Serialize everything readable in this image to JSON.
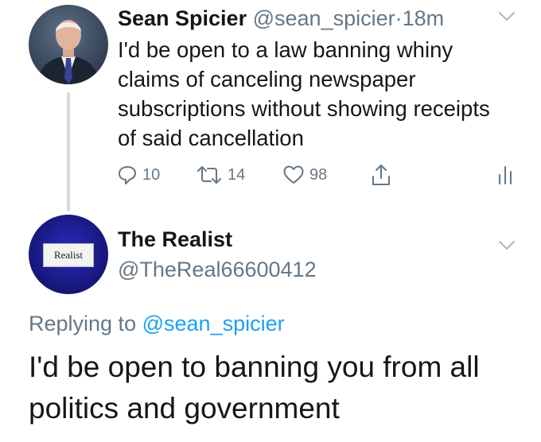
{
  "tweet": {
    "name": "Sean Spicier",
    "handle": "@sean_spicier",
    "separator": "·",
    "time": "18m",
    "text": "I'd be open to a law banning whiny claims of canceling newspaper subscriptions without showing receipts of said cancellation",
    "replies": "10",
    "retweets": "14",
    "likes": "98"
  },
  "reply_tweet": {
    "name": "The Realist",
    "handle": "@TheReal66600412",
    "avatar_card_text": "Realist",
    "replying_prefix": "Replying to",
    "replying_to": "@sean_spicier",
    "text": "I'd be open to banning you from all politics and government"
  },
  "colors": {
    "text": "#14171a",
    "secondary": "#657786",
    "link": "#1da1f2",
    "thread_line": "#d4dbe1"
  },
  "icons": [
    "chevron-down-icon",
    "reply-icon",
    "retweet-icon",
    "like-icon",
    "share-icon",
    "analytics-icon"
  ]
}
